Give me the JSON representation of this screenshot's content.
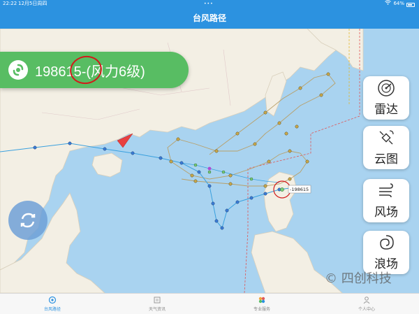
{
  "status_bar": {
    "time": "22:22",
    "date": "12月5日周四",
    "battery": "64%"
  },
  "nav": {
    "title": "台风路径"
  },
  "typhoon": {
    "label": "198615-(风力6级)",
    "marker_label": "-198615"
  },
  "side_buttons": [
    {
      "label": "雷达",
      "icon": "radar-icon"
    },
    {
      "label": "云图",
      "icon": "satellite-icon"
    },
    {
      "label": "风场",
      "icon": "wind-icon"
    },
    {
      "label": "浪场",
      "icon": "wave-icon"
    }
  ],
  "watermark": "四创科技",
  "tabs": [
    {
      "label": "台风路径",
      "icon": "typhoon-tab-icon",
      "active": true
    },
    {
      "label": "天气资讯",
      "icon": "news-tab-icon",
      "active": false
    },
    {
      "label": "专业服务",
      "icon": "service-tab-icon",
      "active": false
    },
    {
      "label": "个人中心",
      "icon": "user-tab-icon",
      "active": false
    }
  ],
  "colors": {
    "accent": "#2c92e0",
    "banner": "#58bd63",
    "track_line": "#3aa0de",
    "annotation": "#d21a1a"
  }
}
